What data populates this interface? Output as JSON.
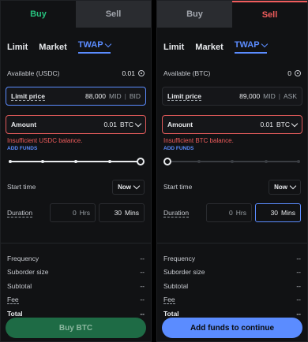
{
  "left": {
    "tabs": {
      "buy": "Buy",
      "sell": "Sell"
    },
    "order_types": {
      "limit": "Limit",
      "market": "Market",
      "twap": "TWAP"
    },
    "available_label": "Available (USDC)",
    "available_value": "0.01",
    "limit_price": {
      "label": "Limit price",
      "value": "88,000",
      "mid": "MID",
      "bid": "BID"
    },
    "amount": {
      "label": "Amount",
      "value": "0.01",
      "unit": "BTC"
    },
    "error": "Insufficient USDC balance.",
    "add_funds": "ADD FUNDS",
    "start_time": {
      "label": "Start time",
      "value": "Now"
    },
    "duration": {
      "label": "Duration",
      "hrs": "0",
      "hrs_label": "Hrs",
      "mins": "30",
      "mins_label": "Mins"
    },
    "stats": [
      {
        "label": "Frequency",
        "value": "--"
      },
      {
        "label": "Suborder size",
        "value": "--"
      },
      {
        "label": "Subtotal",
        "value": "--"
      },
      {
        "label": "Fee",
        "value": "--"
      },
      {
        "label": "Total",
        "value": "--"
      }
    ],
    "cta": "Buy BTC"
  },
  "right": {
    "tabs": {
      "buy": "Buy",
      "sell": "Sell"
    },
    "order_types": {
      "limit": "Limit",
      "market": "Market",
      "twap": "TWAP"
    },
    "available_label": "Available (BTC)",
    "available_value": "0",
    "limit_price": {
      "label": "Limit price",
      "value": "89,000",
      "mid": "MID",
      "ask": "ASK"
    },
    "amount": {
      "label": "Amount",
      "value": "0.01",
      "unit": "BTC"
    },
    "error": "Insufficient BTC balance.",
    "add_funds": "ADD FUNDS",
    "start_time": {
      "label": "Start time",
      "value": "Now"
    },
    "duration": {
      "label": "Duration",
      "hrs": "0",
      "hrs_label": "Hrs",
      "mins": "30",
      "mins_label": "Mins"
    },
    "stats": [
      {
        "label": "Frequency",
        "value": "--"
      },
      {
        "label": "Suborder size",
        "value": "--"
      },
      {
        "label": "Subtotal",
        "value": "--"
      },
      {
        "label": "Fee",
        "value": "--"
      },
      {
        "label": "Total",
        "value": "--"
      }
    ],
    "cta": "Add funds to continue"
  },
  "colors": {
    "buy": "#27c07d",
    "sell": "#f05c5c",
    "accent": "#5b8cff"
  },
  "slider": {
    "left_fraction": 1.0,
    "right_fraction": 0.0
  }
}
